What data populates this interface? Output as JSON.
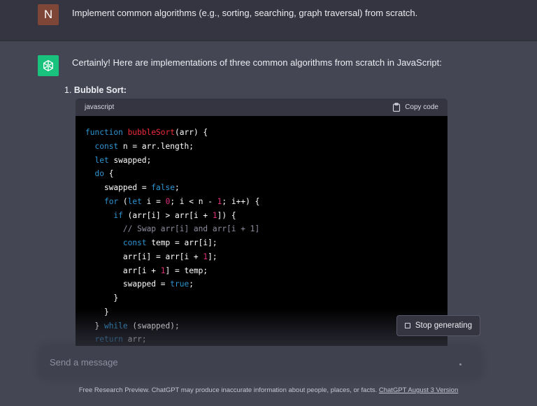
{
  "user_message": {
    "avatar_letter": "N",
    "text": "Implement common algorithms (e.g., sorting, searching, graph traversal) from scratch."
  },
  "assistant_message": {
    "intro": "Certainly! Here are implementations of three common algorithms from scratch in JavaScript:",
    "list_number": "1.",
    "list_title": "Bubble Sort:",
    "code_block": {
      "language": "javascript",
      "copy_label": "Copy code"
    }
  },
  "stop_button": {
    "label": "Stop generating"
  },
  "composer": {
    "placeholder": "Send a message"
  },
  "footer": {
    "text": "Free Research Preview. ChatGPT may produce inaccurate information about people, places, or facts.",
    "link": "ChatGPT August 3 Version"
  },
  "colors": {
    "background": "#343541",
    "assistant_bg": "#444654",
    "user_avatar": "#7d4636",
    "gpt_avatar": "#19c37d",
    "keyword": "#2e95d3",
    "function_name": "#f22c3d",
    "number": "#df3079"
  },
  "icons": [
    "openai-logo-icon",
    "clipboard-icon",
    "stop-square-icon"
  ]
}
